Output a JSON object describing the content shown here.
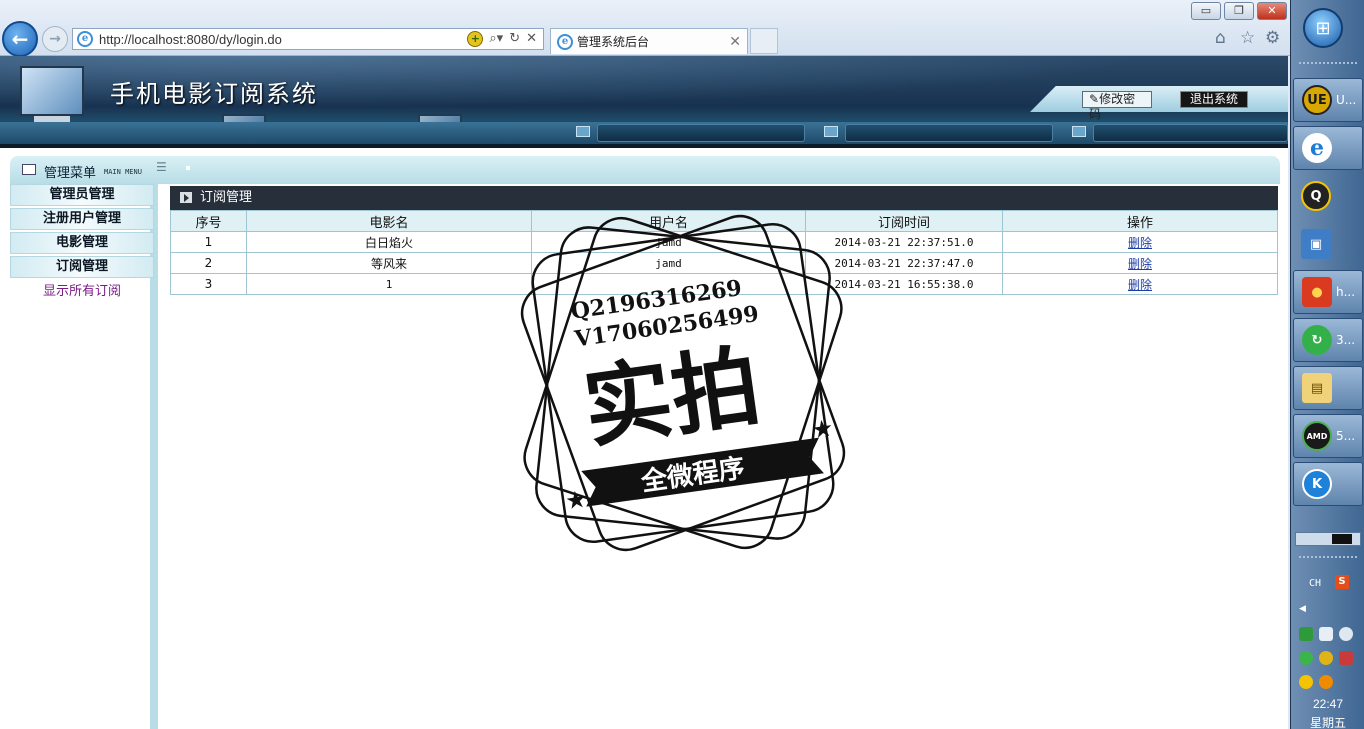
{
  "browser": {
    "url": "http://localhost:8080/dy/login.do",
    "tab_title": "管理系统后台",
    "controls": {
      "minimize": "▭",
      "maximize": "❐",
      "close": "✕"
    }
  },
  "header": {
    "title": "手机电影订阅系统",
    "change_password": "修改密码",
    "logout": "退出系统"
  },
  "sidebar": {
    "title": "管理菜单",
    "subtitle": "MAIN MENU",
    "items": [
      {
        "label": "管理员管理"
      },
      {
        "label": "注册用户管理"
      },
      {
        "label": "电影管理"
      },
      {
        "label": "订阅管理"
      }
    ],
    "sublink": "显示所有订阅"
  },
  "main": {
    "panel_title": "订阅管理",
    "columns": [
      "序号",
      "电影名",
      "用户名",
      "订阅时间",
      "操作"
    ],
    "rows": [
      {
        "no": "1",
        "movie": "白日焰火",
        "user": "jamd",
        "time": "2014-03-21 22:37:51.0",
        "action": "删除"
      },
      {
        "no": "2",
        "movie": "等风来",
        "user": "jamd",
        "time": "2014-03-21 22:37:47.0",
        "action": "删除"
      },
      {
        "no": "3",
        "movie": "1",
        "user": "",
        "time": "2014-03-21 16:55:38.0",
        "action": "删除"
      }
    ]
  },
  "watermark": {
    "qq": "Q2196316269",
    "vx": "V17060256499",
    "big_text": "实拍",
    "banner": "全微程序"
  },
  "taskbar": {
    "items": [
      {
        "icon": "ultraedit-icon",
        "label": "U..."
      },
      {
        "icon": "ie-icon",
        "label": ""
      },
      {
        "icon": "qq-icon",
        "label": ""
      },
      {
        "icon": "remote-desktop-icon",
        "label": ""
      },
      {
        "icon": "mascot-icon",
        "label": "h..."
      },
      {
        "icon": "refresh-app-icon",
        "label": "3..."
      },
      {
        "icon": "explorer-icon",
        "label": ""
      },
      {
        "icon": "amd-icon",
        "label": "5..."
      },
      {
        "icon": "k-app-icon",
        "label": ""
      }
    ],
    "lang": "CH",
    "ime": "S",
    "time": "22:47",
    "weekday": "星期五"
  }
}
